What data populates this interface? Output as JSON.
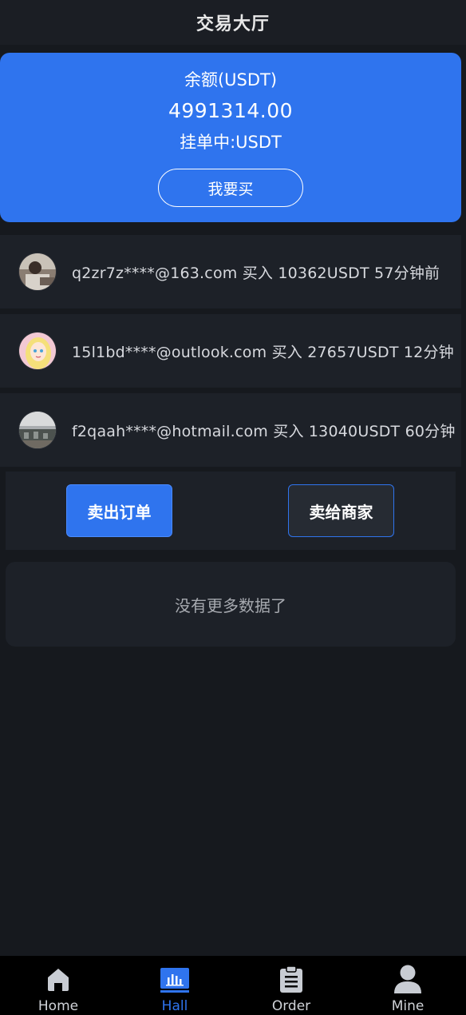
{
  "header": {
    "title": "交易大厅"
  },
  "balance": {
    "label": "余额(USDT)",
    "value": "4991314.00",
    "pending_label": "挂单中:USDT",
    "buy_button": "我要买"
  },
  "trades": [
    {
      "text": "q2zr7z****@163.com 买入 10362USDT 57分钟前",
      "avatar": "photo-avatar-icon"
    },
    {
      "text": "15l1bd****@outlook.com 买入 27657USDT 12分钟",
      "avatar": "cartoon-girl-avatar-icon"
    },
    {
      "text": "f2qaah****@hotmail.com 买入 13040USDT 60分钟",
      "avatar": "photo-avatar-icon"
    }
  ],
  "actions": {
    "sell_order": "卖出订单",
    "sell_merchant": "卖给商家"
  },
  "empty": {
    "text": "没有更多数据了"
  },
  "tabbar": {
    "active": "Hall",
    "accent_color": "#2f74ee",
    "tabs": [
      {
        "label": "Home",
        "icon": "home-icon"
      },
      {
        "label": "Hall",
        "icon": "chart-icon"
      },
      {
        "label": "Order",
        "icon": "clipboard-icon"
      },
      {
        "label": "Mine",
        "icon": "user-icon"
      }
    ]
  }
}
